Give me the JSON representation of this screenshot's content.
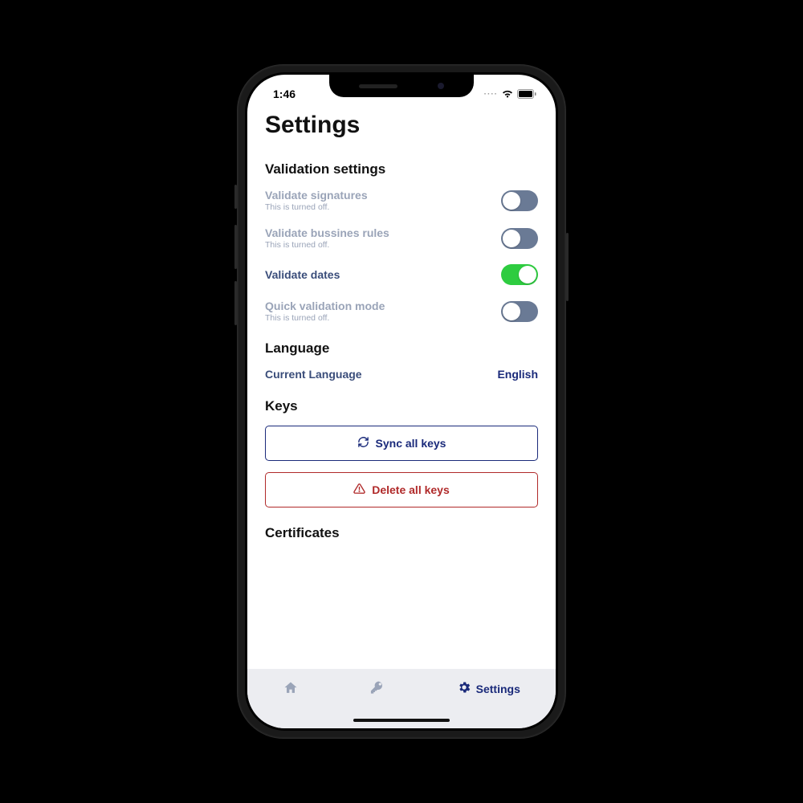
{
  "status": {
    "time": "1:46"
  },
  "page": {
    "title": "Settings"
  },
  "validation": {
    "heading": "Validation settings",
    "off_sub": "This is turned off.",
    "sig": {
      "label": "Validate signatures"
    },
    "rules": {
      "label": "Validate bussines rules"
    },
    "dates": {
      "label": "Validate dates"
    },
    "quick": {
      "label": "Quick validation mode"
    }
  },
  "language": {
    "heading": "Language",
    "label": "Current Language",
    "value": "English"
  },
  "keys": {
    "heading": "Keys",
    "sync": "Sync all keys",
    "delete": "Delete all keys"
  },
  "certs": {
    "heading": "Certificates"
  },
  "tabs": {
    "settings": "Settings"
  }
}
